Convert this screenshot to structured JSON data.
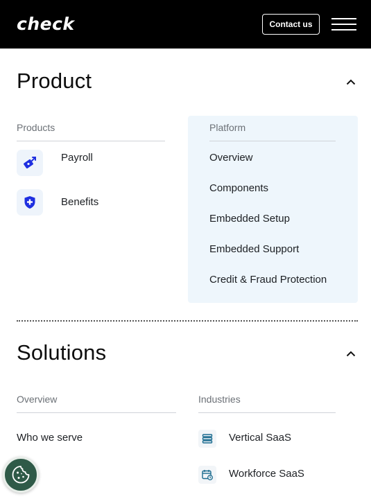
{
  "header": {
    "logo_text": "check",
    "contact_label": "Contact us",
    "menu_icon": "hamburger-menu-icon"
  },
  "product": {
    "title": "Product",
    "products_heading": "Products",
    "products": [
      {
        "label": "Payroll",
        "icon": "payroll-money-icon"
      },
      {
        "label": "Benefits",
        "icon": "benefits-shield-icon"
      }
    ],
    "platform_heading": "Platform",
    "platform_items": [
      {
        "label": "Overview"
      },
      {
        "label": "Components"
      },
      {
        "label": "Embedded Setup"
      },
      {
        "label": "Embedded Support"
      },
      {
        "label": "Credit & Fraud Protection"
      }
    ]
  },
  "solutions": {
    "title": "Solutions",
    "overview_heading": "Overview",
    "overview_items": [
      {
        "label": "Who we serve"
      }
    ],
    "industries_heading": "Industries",
    "industries_items": [
      {
        "label": "Vertical SaaS",
        "icon": "stacked-layers-icon"
      },
      {
        "label": "Workforce SaaS",
        "icon": "calendar-clock-icon"
      }
    ]
  },
  "colors": {
    "header_bg": "#000000",
    "accent_blue": "#1f2fe0",
    "panel_bg": "#eef6fc",
    "cookie_green": "#2f5a48"
  }
}
